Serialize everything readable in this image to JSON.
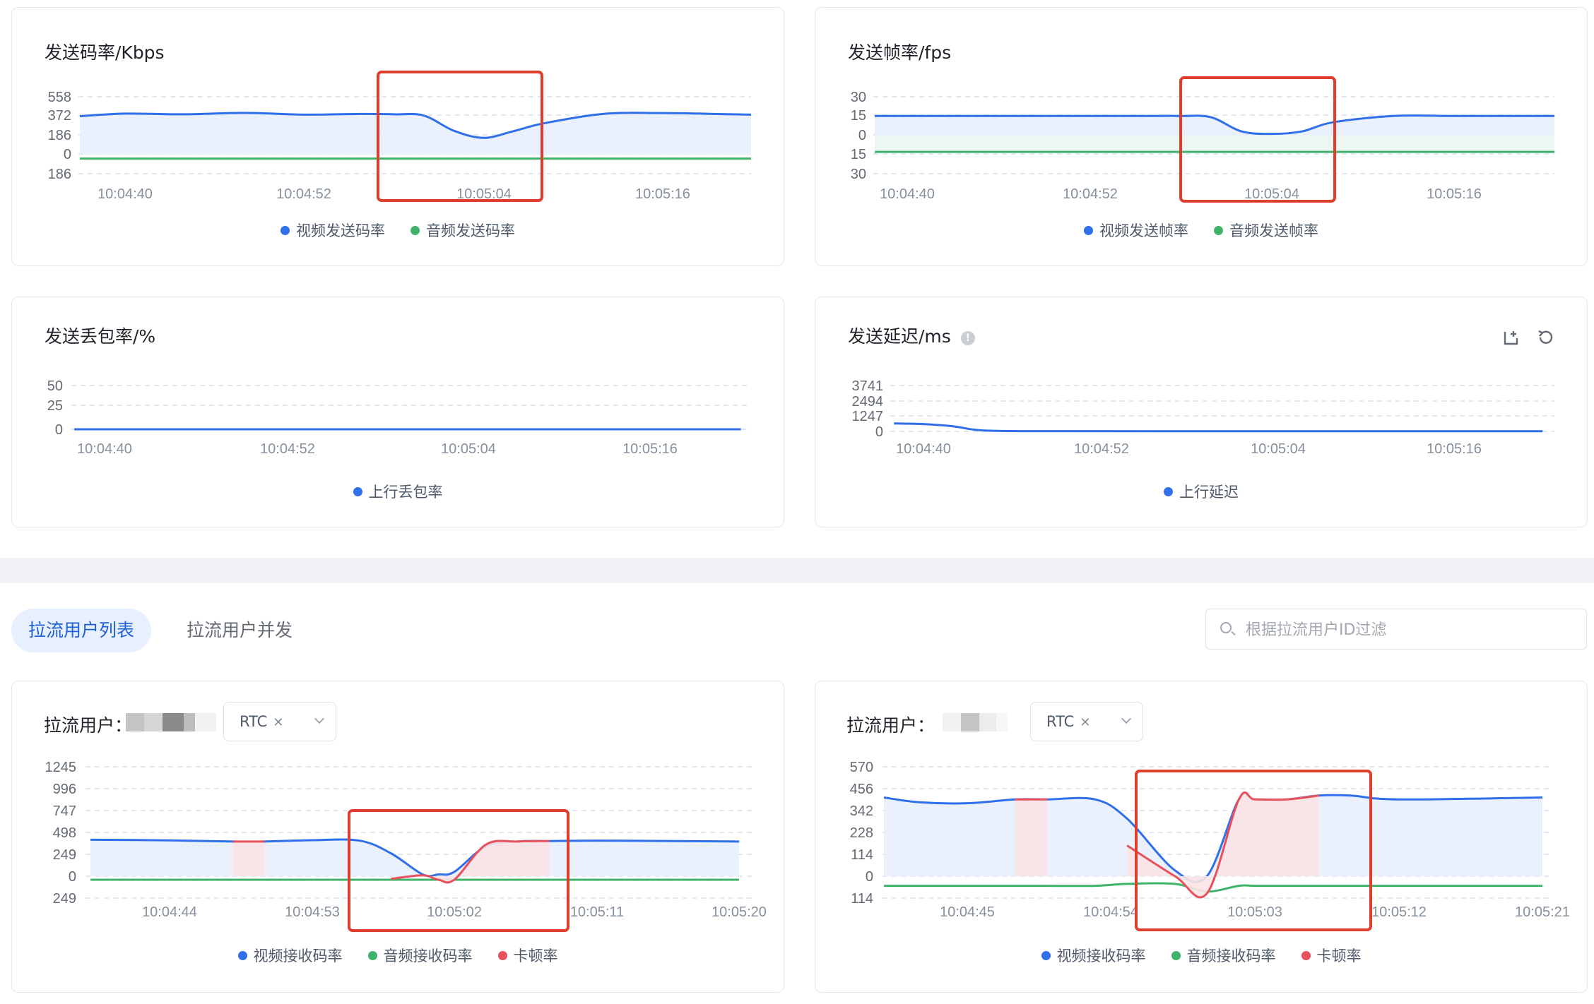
{
  "colors": {
    "blue": "#2f6fea",
    "green": "#3fb36a",
    "red": "#e8505b",
    "highlight": "#e03e2d",
    "grid": "#dfe6f2"
  },
  "send_bitrate": {
    "title": "发送码率/Kbps",
    "legend": [
      {
        "label": "视频发送码率",
        "color": "#2f6fea"
      },
      {
        "label": "音频发送码率",
        "color": "#3fb36a"
      }
    ]
  },
  "send_framerate": {
    "title": "发送帧率/fps",
    "legend": [
      {
        "label": "视频发送帧率",
        "color": "#2f6fea"
      },
      {
        "label": "音频发送帧率",
        "color": "#3fb36a"
      }
    ]
  },
  "send_loss": {
    "title": "发送丢包率/%",
    "legend": [
      {
        "label": "上行丢包率",
        "color": "#2f6fea"
      }
    ]
  },
  "send_delay": {
    "title": "发送延迟/ms",
    "info_icon": "info-icon",
    "tools": [
      "export-icon",
      "reset-icon"
    ],
    "legend": [
      {
        "label": "上行延迟",
        "color": "#2f6fea"
      }
    ]
  },
  "tabs": [
    {
      "label": "拉流用户列表",
      "active": true
    },
    {
      "label": "拉流用户并发",
      "active": false
    }
  ],
  "search": {
    "placeholder": "根据拉流用户ID过滤"
  },
  "pull_user_left": {
    "label": "拉流用户：",
    "tag": "RTC",
    "legend": [
      {
        "label": "视频接收码率",
        "color": "#2f6fea"
      },
      {
        "label": "音频接收码率",
        "color": "#3fb36a"
      },
      {
        "label": "卡顿率",
        "color": "#e8505b"
      }
    ]
  },
  "pull_user_right": {
    "label": "拉流用户：",
    "tag": "RTC",
    "legend": [
      {
        "label": "视频接收码率",
        "color": "#2f6fea"
      },
      {
        "label": "音频接收码率",
        "color": "#3fb36a"
      },
      {
        "label": "卡顿率",
        "color": "#e8505b"
      }
    ]
  },
  "chart_data": [
    {
      "id": "send_bitrate",
      "type": "line",
      "title": "发送码率/Kbps",
      "y_ticks": [
        "558",
        "372",
        "186",
        "0",
        "186"
      ],
      "x_ticks": [
        "10:04:40",
        "10:04:52",
        "10:05:04",
        "10:05:16"
      ],
      "x": [
        "10:04:36",
        "10:04:40",
        "10:04:44",
        "10:04:48",
        "10:04:52",
        "10:04:56",
        "10:04:58",
        "10:05:00",
        "10:05:02",
        "10:05:04",
        "10:05:06",
        "10:05:08",
        "10:05:12",
        "10:05:16",
        "10:05:20",
        "10:05:24"
      ],
      "series": [
        {
          "name": "视频发送码率",
          "color": "#2f6fea",
          "fill": "#e8f0fd",
          "values": [
            370,
            395,
            388,
            402,
            385,
            392,
            388,
            376,
            230,
            160,
            225,
            300,
            392,
            400,
            390,
            385
          ]
        },
        {
          "name": "音频发送码率",
          "color": "#3fb36a",
          "values": [
            -40,
            -40,
            -40,
            -40,
            -40,
            -40,
            -40,
            -40,
            -40,
            -40,
            -40,
            -40,
            -40,
            -40,
            -40,
            -40
          ]
        }
      ],
      "ylim": [
        -186,
        558
      ]
    },
    {
      "id": "send_framerate",
      "type": "line",
      "title": "发送帧率/fps",
      "y_ticks": [
        "30",
        "15",
        "0",
        "15",
        "30"
      ],
      "x_ticks": [
        "10:04:40",
        "10:04:52",
        "10:05:04",
        "10:05:16"
      ],
      "x": [
        "10:04:36",
        "10:04:40",
        "10:04:44",
        "10:04:48",
        "10:04:52",
        "10:04:56",
        "10:04:58",
        "10:05:00",
        "10:05:02",
        "10:05:04",
        "10:05:06",
        "10:05:08",
        "10:05:12",
        "10:05:16",
        "10:05:20",
        "10:05:24"
      ],
      "series": [
        {
          "name": "视频发送帧率",
          "color": "#2f6fea",
          "fill": "#e8f0fd",
          "values": [
            15,
            15,
            15,
            15,
            15,
            15,
            15,
            14,
            3,
            1,
            3,
            10,
            15,
            15,
            15,
            15
          ]
        },
        {
          "name": "音频发送帧率",
          "color": "#3fb36a",
          "fill": "#e9f6ee",
          "values": [
            -13,
            -13,
            -13,
            -13,
            -13,
            -13,
            -13,
            -13,
            -13,
            -13,
            -13,
            -13,
            -13,
            -13,
            -13,
            -13
          ]
        }
      ],
      "ylim": [
        -30,
        30
      ]
    },
    {
      "id": "send_loss",
      "type": "line",
      "title": "发送丢包率/%",
      "y_ticks": [
        "50",
        "25",
        "0"
      ],
      "x_ticks": [
        "10:04:40",
        "10:04:52",
        "10:05:04",
        "10:05:16"
      ],
      "x": [
        "10:04:38",
        "10:05:22"
      ],
      "series": [
        {
          "name": "上行丢包率",
          "color": "#2f6fea",
          "values": [
            0,
            0
          ]
        }
      ],
      "ylim": [
        0,
        50
      ]
    },
    {
      "id": "send_delay",
      "type": "line",
      "title": "发送延迟/ms",
      "y_ticks": [
        "3741",
        "2494",
        "1247",
        "0"
      ],
      "x_ticks": [
        "10:04:40",
        "10:04:52",
        "10:05:04",
        "10:05:16"
      ],
      "x": [
        "10:04:38",
        "10:04:40",
        "10:04:42",
        "10:04:44",
        "10:04:48",
        "10:05:00",
        "10:05:12",
        "10:05:22"
      ],
      "series": [
        {
          "name": "上行延迟",
          "color": "#2f6fea",
          "values": [
            650,
            600,
            420,
            80,
            20,
            15,
            15,
            15
          ]
        }
      ],
      "ylim": [
        0,
        3741
      ]
    },
    {
      "id": "pull_left",
      "type": "line",
      "y_ticks": [
        "1245",
        "996",
        "747",
        "498",
        "249",
        "0",
        "249"
      ],
      "x_ticks": [
        "10:04:44",
        "10:04:53",
        "10:05:02",
        "10:05:11",
        "10:05:20"
      ],
      "x": [
        "10:04:39",
        "10:04:44",
        "10:04:48",
        "10:04:50",
        "10:04:53",
        "10:04:56",
        "10:04:58",
        "10:05:00",
        "10:05:01",
        "10:05:02",
        "10:05:04",
        "10:05:06",
        "10:05:08",
        "10:05:11",
        "10:05:16",
        "10:05:20"
      ],
      "series": [
        {
          "name": "视频接收码率",
          "color": "#2f6fea",
          "fill": "#e8f0fd",
          "values": [
            415,
            408,
            395,
            395,
            410,
            405,
            260,
            20,
            20,
            50,
            340,
            395,
            400,
            405,
            400,
            395
          ]
        },
        {
          "name": "音频接收码率",
          "color": "#3fb36a",
          "values": [
            -40,
            -40,
            -40,
            -40,
            -40,
            -40,
            -40,
            -40,
            -40,
            -40,
            -40,
            -40,
            -40,
            -40,
            -40,
            -40
          ]
        },
        {
          "name": "卡顿率",
          "color": "#e8505b",
          "fill": "#fbe3e6",
          "values": [
            null,
            null,
            395,
            395,
            null,
            null,
            -30,
            10,
            -40,
            -40,
            360,
            395,
            400,
            null,
            null,
            null
          ]
        }
      ],
      "ylim": [
        -249,
        1245
      ]
    },
    {
      "id": "pull_right",
      "type": "line",
      "y_ticks": [
        "570",
        "456",
        "342",
        "228",
        "114",
        "0",
        "114"
      ],
      "x_ticks": [
        "10:04:45",
        "10:04:54",
        "10:05:03",
        "10:05:12",
        "10:05:21"
      ],
      "x": [
        "10:04:39",
        "10:04:42",
        "10:04:45",
        "10:04:48",
        "10:04:50",
        "10:04:53",
        "10:04:55",
        "10:04:58",
        "10:05:00",
        "10:05:02",
        "10:05:03",
        "10:05:05",
        "10:05:07",
        "10:05:09",
        "10:05:12",
        "10:05:21"
      ],
      "series": [
        {
          "name": "视频接收码率",
          "color": "#2f6fea",
          "fill": "#e8f0fd",
          "values": [
            410,
            385,
            380,
            400,
            400,
            400,
            300,
            30,
            0,
            400,
            400,
            400,
            420,
            420,
            400,
            410
          ]
        },
        {
          "name": "音频接收码率",
          "color": "#3fb36a",
          "values": [
            -50,
            -50,
            -50,
            -50,
            -50,
            -50,
            -40,
            -40,
            -80,
            -50,
            -50,
            -50,
            -50,
            -50,
            -50,
            -50
          ]
        },
        {
          "name": "卡顿率",
          "color": "#e8505b",
          "fill": "#fbe3e6",
          "values": [
            null,
            null,
            null,
            400,
            400,
            null,
            160,
            0,
            -90,
            400,
            400,
            400,
            420,
            null,
            null,
            -50
          ]
        }
      ],
      "ylim": [
        -114,
        570
      ]
    }
  ]
}
